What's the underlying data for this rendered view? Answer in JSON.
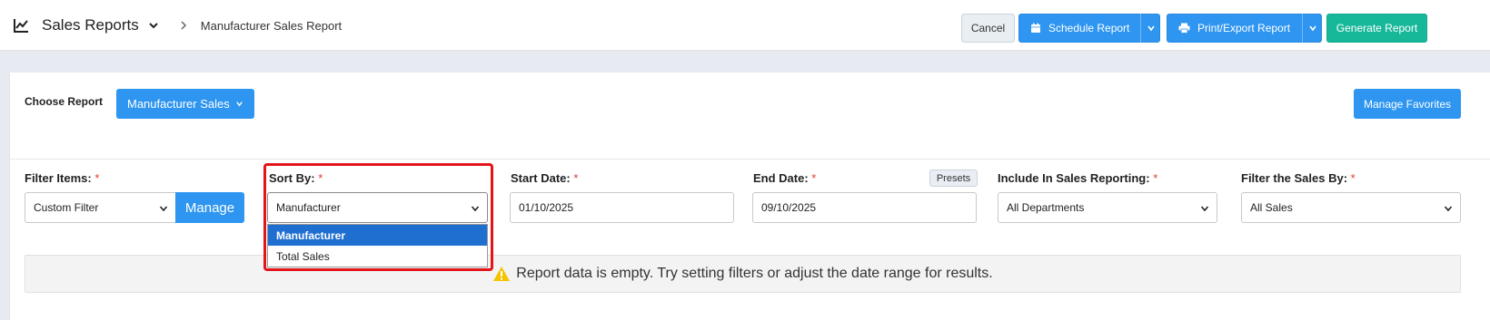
{
  "header": {
    "app_title": "Sales Reports",
    "breadcrumb_current": "Manufacturer Sales Report",
    "buttons": {
      "cancel": "Cancel",
      "schedule": "Schedule Report",
      "print_export": "Print/Export Report",
      "generate": "Generate Report"
    }
  },
  "choose_report": {
    "label": "Choose Report",
    "selected": "Manufacturer Sales",
    "manage_favorites": "Manage Favorites"
  },
  "filters": {
    "filter_items": {
      "label": "Filter Items:",
      "value": "Custom Filter",
      "manage_label": "Manage"
    },
    "sort_by": {
      "label": "Sort By:",
      "value": "Manufacturer",
      "options": [
        "Manufacturer",
        "Total Sales"
      ]
    },
    "start_date": {
      "label": "Start Date:",
      "value": "01/10/2025"
    },
    "end_date": {
      "label": "End Date:",
      "value": "09/10/2025",
      "presets_label": "Presets"
    },
    "include": {
      "label": "Include In Sales Reporting:",
      "value": "All Departments"
    },
    "filter_sales_by": {
      "label": "Filter the Sales By:",
      "value": "All Sales"
    },
    "required_marker": "*"
  },
  "empty_message": "Report data is empty. Try setting filters or adjust the date range for results.",
  "colors": {
    "primary": "#2e95f0",
    "generate": "#17b89a",
    "highlight": "#e3151b",
    "selected_option": "#1f6fd1"
  }
}
